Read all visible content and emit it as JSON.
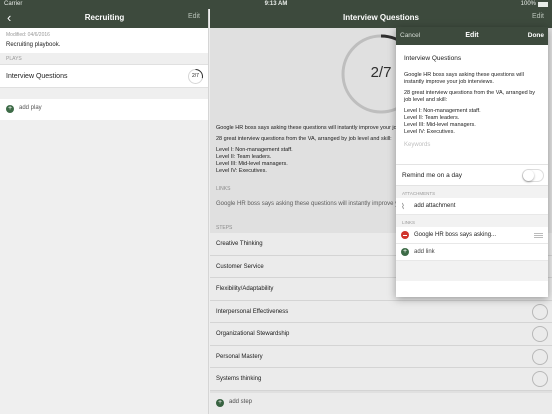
{
  "statusbar": {
    "carrier": "Carrier",
    "time": "9:13 AM",
    "battery": "100%"
  },
  "left": {
    "back_icon": "chevron-left-icon",
    "title": "Recruiting",
    "edit_label": "Edit",
    "modified": "Modified: 04/6/2016",
    "description": "Recruiting playbook.",
    "plays_header": "PLAYS",
    "plays": [
      {
        "name": "Interview Questions",
        "progress": "2/7",
        "progress_fraction": 0.2857
      }
    ],
    "add_play_label": "add play"
  },
  "main": {
    "title": "Interview Questions",
    "edit_label": "Edit",
    "progress": "2/7",
    "progress_fraction": 0.2857,
    "description": [
      "Google HR boss says asking these questions will instantly improve your job interviews.",
      "28 great interview questions from the VA, arranged by job level and skill:",
      "Level I: Non-management staff.\nLevel II: Team leaders.\nLevel III: Mid-level managers.\nLevel IV: Executives."
    ],
    "links_header": "LINKS",
    "link_text": "Google HR boss says asking these questions will instantly improve your job interviews.",
    "steps_header": "STEPS",
    "steps": [
      "Creative Thinking",
      "Customer Service",
      "Flexibility/Adaptability",
      "Interpersonal Effectiveness",
      "Organizational Stewardship",
      "Personal Mastery",
      "Systems thinking"
    ],
    "add_step_label": "add step"
  },
  "popover": {
    "cancel_label": "Cancel",
    "title": "Edit",
    "done_label": "Done",
    "name_value": "Interview Questions",
    "description": [
      "Google HR boss says asking these questions will instantly improve your job interviews.",
      "28 great interview questions from the VA, arranged by job level and skill:",
      "Level I: Non-management staff.\nLevel II: Team leaders.\nLevel III: Mid-level managers.\nLevel IV: Executives."
    ],
    "keywords_placeholder": "Keywords",
    "remind_label": "Remind me on a day",
    "remind_on": false,
    "attachments_header": "ATTACHMENTS",
    "add_attachment_label": "add attachment",
    "links_header": "LINKS",
    "link_label": "Google HR boss says asking...",
    "add_link_label": "add link"
  },
  "colors": {
    "navbar": "#3d4a3d",
    "accent_green": "#3d6b47",
    "delete_red": "#d0342c"
  }
}
